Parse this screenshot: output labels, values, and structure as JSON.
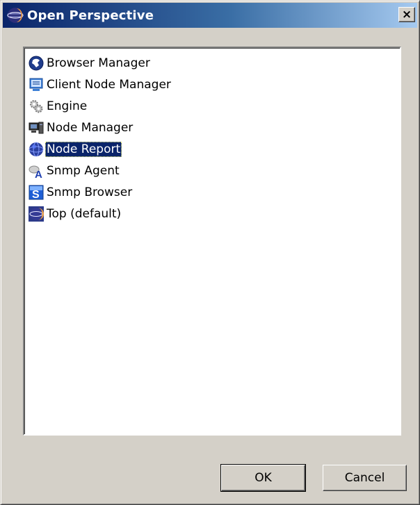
{
  "window": {
    "title": "Open Perspective",
    "close_label": "×",
    "title_icon": "eclipse-icon"
  },
  "perspectives": {
    "selected": "Node Report",
    "items": [
      {
        "label": "Browser Manager",
        "icon": "browser-manager-icon"
      },
      {
        "label": "Client Node Manager",
        "icon": "client-node-manager-icon"
      },
      {
        "label": "Engine",
        "icon": "gears-icon"
      },
      {
        "label": "Node Manager",
        "icon": "computer-icon"
      },
      {
        "label": "Node Report",
        "icon": "globe-icon"
      },
      {
        "label": "Snmp Agent",
        "icon": "snmp-agent-icon"
      },
      {
        "label": "Snmp Browser",
        "icon": "snmp-browser-icon"
      },
      {
        "label": "Top (default)",
        "icon": "eclipse-icon"
      }
    ]
  },
  "buttons": {
    "ok": "OK",
    "cancel": "Cancel"
  },
  "colors": {
    "title_gradient_start": "#0a246a",
    "title_gradient_end": "#a6caf0",
    "selection_bg": "#0a246a",
    "dialog_bg": "#d4d0c8"
  }
}
